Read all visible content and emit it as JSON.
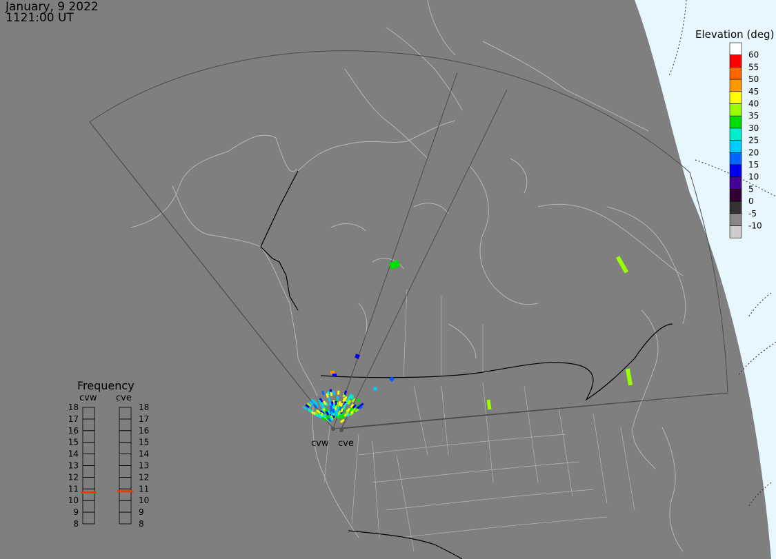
{
  "header": {
    "date": "January, 9 2022",
    "time": "1121:00 UT"
  },
  "colors": {
    "background": "#7f7f7f",
    "dayside": "#e8f6fe",
    "coast": "#b8b8b8",
    "fov": "#4a4a4a",
    "border": "#000000",
    "freq_marker": "#ff3300"
  },
  "elevation_legend": {
    "title": "Elevation (deg)",
    "scale": [
      {
        "label": "60",
        "color": "#ffffff"
      },
      {
        "label": "55",
        "color": "#ff0000"
      },
      {
        "label": "50",
        "color": "#ff6600"
      },
      {
        "label": "45",
        "color": "#ff9900"
      },
      {
        "label": "40",
        "color": "#ffff00"
      },
      {
        "label": "35",
        "color": "#99ff00"
      },
      {
        "label": "30",
        "color": "#00dd00"
      },
      {
        "label": "25",
        "color": "#00eecc"
      },
      {
        "label": "20",
        "color": "#00ccff"
      },
      {
        "label": "15",
        "color": "#0066ff"
      },
      {
        "label": "10",
        "color": "#0000ee"
      },
      {
        "label": "5",
        "color": "#440099"
      },
      {
        "label": "0",
        "color": "#330033"
      },
      {
        "label": "-5",
        "color": "#333333"
      },
      {
        "label": "-10",
        "color": "#888888"
      },
      {
        "label": "",
        "color": "#cccccc"
      }
    ]
  },
  "radars": {
    "labels": [
      "cvw",
      "cve"
    ]
  },
  "frequency_panel": {
    "title": "Frequency",
    "columns": [
      {
        "name": "cvw",
        "current_mhz": 10.7
      },
      {
        "name": "cve",
        "current_mhz": 10.8
      }
    ],
    "scale": [
      "18",
      "17",
      "16",
      "15",
      "14",
      "13",
      "12",
      "11",
      "10",
      "9",
      "8"
    ]
  }
}
